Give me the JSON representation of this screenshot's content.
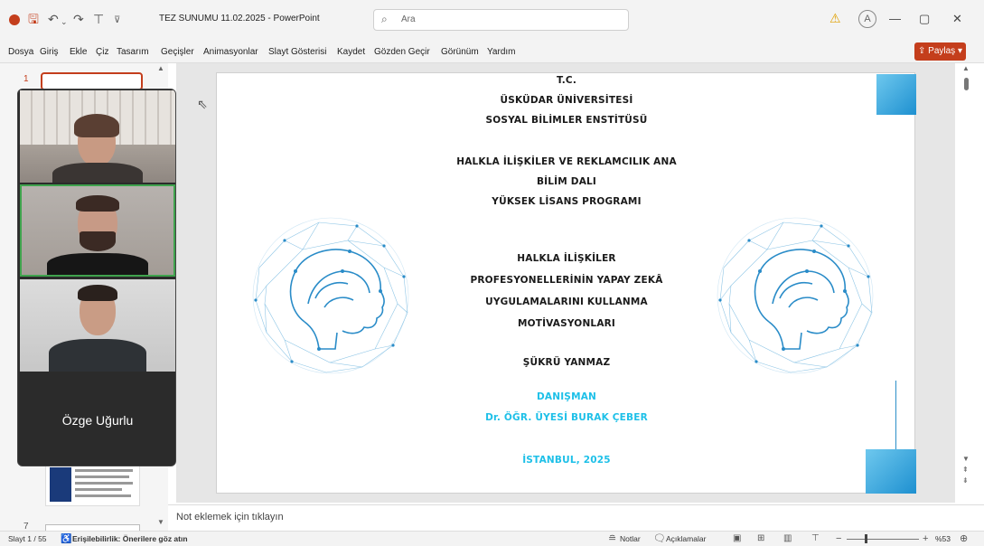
{
  "titlebar": {
    "doc_title": "TEZ SUNUMU 11.02.2025 - PowerPoint",
    "search_placeholder": "Ara",
    "avatar_initial": "A"
  },
  "menu": {
    "items": [
      "Dosya",
      "Giriş",
      "Ekle",
      "Çiz",
      "Tasarım",
      "Geçişler",
      "Animasyonlar",
      "Slayt Gösterisi",
      "Kaydet",
      "Gözden Geçir",
      "Görünüm",
      "Yardım"
    ],
    "share_label": "Paylaş"
  },
  "thumbnails": {
    "first_number": "1",
    "last_number": "7"
  },
  "call": {
    "participant_name": "Özge Uğurlu"
  },
  "slide": {
    "lines": {
      "tc": "T.C.",
      "university": "ÜSKÜDAR ÜNİVERSİTESİ",
      "institute": "SOSYAL BİLİMLER ENSTİTÜSÜ",
      "dept1": "HALKLA İLİŞKİLER VE REKLAMCILIK ANA",
      "dept2": "BİLİM DALI",
      "program": "YÜKSEK LİSANS PROGRAMI",
      "title1": "HALKLA İLİŞKİLER",
      "title2": "PROFESYONELLERİNİN YAPAY ZEKÂ",
      "title3": "UYGULAMALARINI KULLANMA",
      "title4": "MOTİVASYONLARI",
      "author": "ŞÜKRÜ YANMAZ",
      "advisor_label": "DANIŞMAN",
      "advisor": "Dr. ÖĞR. ÜYESİ BURAK ÇEBER",
      "place_year": "İSTANBUL, 2025"
    },
    "accent_color": "#1ec0e8"
  },
  "notes": {
    "placeholder": "Not eklemek için tıklayın"
  },
  "status": {
    "slide_counter": "Slayt 1 / 55",
    "accessibility": "Erişilebilirlik: Önerilere göz atın",
    "notes_label": "Notlar",
    "comments_label": "Açıklamalar",
    "zoom": "%53"
  },
  "colors": {
    "brand": "#c43e1c",
    "speaking_border": "#3fa34d"
  }
}
